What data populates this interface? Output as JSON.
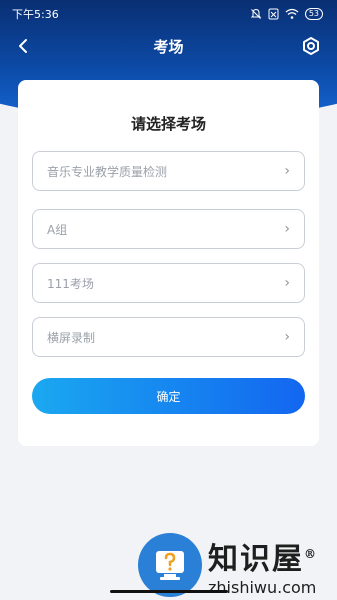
{
  "status": {
    "time": "下午5:36",
    "battery": "53"
  },
  "nav": {
    "title": "考场"
  },
  "card": {
    "title": "请选择考场",
    "fields": [
      {
        "label": "音乐专业教学质量检测"
      },
      {
        "label": "A组"
      },
      {
        "label": "111考场"
      },
      {
        "label": "横屏录制"
      }
    ],
    "confirm": "确定"
  },
  "watermark": {
    "cn": "知识屋",
    "reg": "®",
    "en": "zhishiwu.com"
  },
  "colors": {
    "accent": "#1366f0",
    "header": "#0c4aa6"
  }
}
